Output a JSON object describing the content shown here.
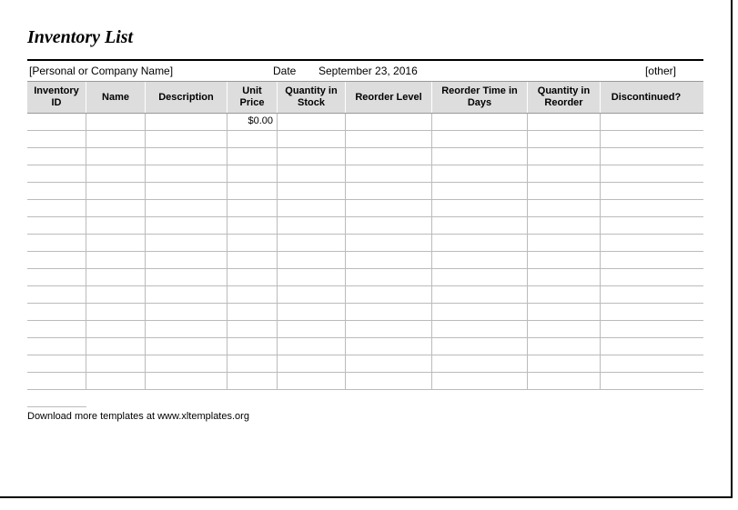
{
  "title": "Inventory List",
  "info": {
    "company": "[Personal or Company Name]",
    "date_label": "Date",
    "date_value": "September 23, 2016",
    "other": "[other]"
  },
  "headers": {
    "id": "Inventory ID",
    "name": "Name",
    "description": "Description",
    "unit_price": "Unit Price",
    "qty_stock": "Quantity in Stock",
    "reorder_level": "Reorder Level",
    "reorder_time": "Reorder Time in Days",
    "qty_reorder": "Quantity in Reorder",
    "discontinued": "Discontinued?"
  },
  "rows": [
    {
      "id": "",
      "name": "",
      "description": "",
      "unit_price": "$0.00",
      "qty_stock": "",
      "reorder_level": "",
      "reorder_time": "",
      "qty_reorder": "",
      "discontinued": ""
    },
    {
      "id": "",
      "name": "",
      "description": "",
      "unit_price": "",
      "qty_stock": "",
      "reorder_level": "",
      "reorder_time": "",
      "qty_reorder": "",
      "discontinued": ""
    },
    {
      "id": "",
      "name": "",
      "description": "",
      "unit_price": "",
      "qty_stock": "",
      "reorder_level": "",
      "reorder_time": "",
      "qty_reorder": "",
      "discontinued": ""
    },
    {
      "id": "",
      "name": "",
      "description": "",
      "unit_price": "",
      "qty_stock": "",
      "reorder_level": "",
      "reorder_time": "",
      "qty_reorder": "",
      "discontinued": ""
    },
    {
      "id": "",
      "name": "",
      "description": "",
      "unit_price": "",
      "qty_stock": "",
      "reorder_level": "",
      "reorder_time": "",
      "qty_reorder": "",
      "discontinued": ""
    },
    {
      "id": "",
      "name": "",
      "description": "",
      "unit_price": "",
      "qty_stock": "",
      "reorder_level": "",
      "reorder_time": "",
      "qty_reorder": "",
      "discontinued": ""
    },
    {
      "id": "",
      "name": "",
      "description": "",
      "unit_price": "",
      "qty_stock": "",
      "reorder_level": "",
      "reorder_time": "",
      "qty_reorder": "",
      "discontinued": ""
    },
    {
      "id": "",
      "name": "",
      "description": "",
      "unit_price": "",
      "qty_stock": "",
      "reorder_level": "",
      "reorder_time": "",
      "qty_reorder": "",
      "discontinued": ""
    },
    {
      "id": "",
      "name": "",
      "description": "",
      "unit_price": "",
      "qty_stock": "",
      "reorder_level": "",
      "reorder_time": "",
      "qty_reorder": "",
      "discontinued": ""
    },
    {
      "id": "",
      "name": "",
      "description": "",
      "unit_price": "",
      "qty_stock": "",
      "reorder_level": "",
      "reorder_time": "",
      "qty_reorder": "",
      "discontinued": ""
    },
    {
      "id": "",
      "name": "",
      "description": "",
      "unit_price": "",
      "qty_stock": "",
      "reorder_level": "",
      "reorder_time": "",
      "qty_reorder": "",
      "discontinued": ""
    },
    {
      "id": "",
      "name": "",
      "description": "",
      "unit_price": "",
      "qty_stock": "",
      "reorder_level": "",
      "reorder_time": "",
      "qty_reorder": "",
      "discontinued": ""
    },
    {
      "id": "",
      "name": "",
      "description": "",
      "unit_price": "",
      "qty_stock": "",
      "reorder_level": "",
      "reorder_time": "",
      "qty_reorder": "",
      "discontinued": ""
    },
    {
      "id": "",
      "name": "",
      "description": "",
      "unit_price": "",
      "qty_stock": "",
      "reorder_level": "",
      "reorder_time": "",
      "qty_reorder": "",
      "discontinued": ""
    },
    {
      "id": "",
      "name": "",
      "description": "",
      "unit_price": "",
      "qty_stock": "",
      "reorder_level": "",
      "reorder_time": "",
      "qty_reorder": "",
      "discontinued": ""
    },
    {
      "id": "",
      "name": "",
      "description": "",
      "unit_price": "",
      "qty_stock": "",
      "reorder_level": "",
      "reorder_time": "",
      "qty_reorder": "",
      "discontinued": ""
    }
  ],
  "footer": "Download more templates at www.xltemplates.org"
}
